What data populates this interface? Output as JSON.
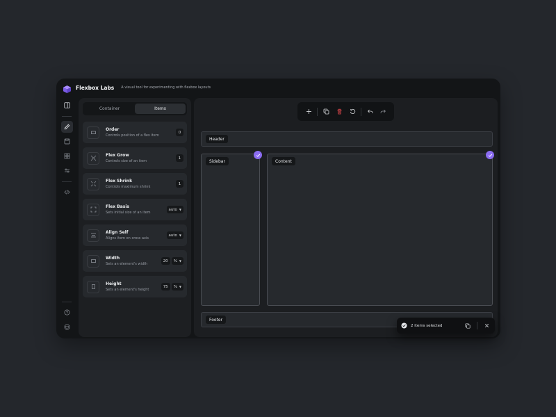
{
  "app": {
    "title": "Flexbox Labs",
    "subtitle": "A visual tool for experimenting with flexbox layouts",
    "accent": "#8b6cf0",
    "danger": "#e5484d"
  },
  "rail": {
    "icons": [
      "panel-icon",
      "pencil-icon",
      "save-icon",
      "grid-icon",
      "sliders-icon",
      "code-icon",
      "help-icon",
      "github-icon"
    ],
    "active": "pencil-icon"
  },
  "panel": {
    "tabs": [
      {
        "label": "Container",
        "active": false
      },
      {
        "label": "Items",
        "active": true
      }
    ],
    "properties": [
      {
        "name": "Order",
        "desc": "Controls position of a flex item",
        "value": "0",
        "unit": null,
        "dropdown": false,
        "icon": "order-icon"
      },
      {
        "name": "Flex Grow",
        "desc": "Controls size of an item",
        "value": "1",
        "unit": null,
        "dropdown": false,
        "icon": "grow-icon"
      },
      {
        "name": "Flex Shrink",
        "desc": "Controls maximum shrink",
        "value": "1",
        "unit": null,
        "dropdown": false,
        "icon": "shrink-icon"
      },
      {
        "name": "Flex Basis",
        "desc": "Sets initial size of an item",
        "value": "auto",
        "unit": null,
        "dropdown": true,
        "icon": "basis-icon"
      },
      {
        "name": "Align Self",
        "desc": "Aligns item on cross axis",
        "value": "auto",
        "unit": null,
        "dropdown": true,
        "icon": "align-icon"
      },
      {
        "name": "Width",
        "desc": "Sets an element's width",
        "value": "20",
        "unit": "%",
        "dropdown": true,
        "icon": "width-icon"
      },
      {
        "name": "Height",
        "desc": "Sets an element's height",
        "value": "75",
        "unit": "%",
        "dropdown": true,
        "icon": "height-icon"
      }
    ]
  },
  "toolbar": {
    "tools": [
      "add-icon",
      "duplicate-icon",
      "delete-icon",
      "reset-icon",
      "undo-icon",
      "redo-icon"
    ]
  },
  "canvas": {
    "header_label": "Header",
    "sidebar_label": "Sidebar",
    "content_label": "Content",
    "footer_label": "Footer",
    "selected": [
      "Sidebar",
      "Content"
    ]
  },
  "toast": {
    "text": "2 items selected"
  }
}
